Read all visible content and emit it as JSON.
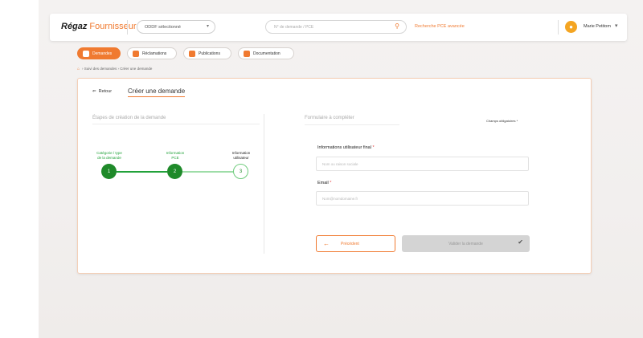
{
  "header": {
    "brand_main": "Régaz",
    "brand_accent": "Fournisseur",
    "pds_select_value": "ODDF sélectionné",
    "search_placeholder": "N° de demande / PCE",
    "advanced_search_label": "Recherche PCE avancée",
    "user_name": "Marie Petitom"
  },
  "nav": {
    "items": [
      {
        "label": "Demandes",
        "active": true
      },
      {
        "label": "Réclamations",
        "active": false
      },
      {
        "label": "Publications",
        "active": false
      },
      {
        "label": "Documentation",
        "active": false
      }
    ]
  },
  "breadcrumb": "› Suivi des demandes › Créer une demande",
  "card": {
    "back_label": "Retour",
    "tab_label": "Créer une demande",
    "steps_title": "Étapes de création de la demande",
    "steps": [
      {
        "label_line1": "Catégorie / type",
        "label_line2": "de la demande",
        "number": "1",
        "state": "done"
      },
      {
        "label_line1": "Information",
        "label_line2": "PCE",
        "number": "2",
        "state": "done"
      },
      {
        "label_line1": "Information",
        "label_line2": "utilisateur",
        "number": "3",
        "state": "todo"
      }
    ],
    "form_title": "Formulaire à compléter",
    "required_note": "Champs obligatoires *",
    "fields": [
      {
        "label": "Informations utilisateur final",
        "required_mark": "*",
        "placeholder": "Nom ou raison sociale"
      },
      {
        "label": "Email",
        "required_mark": "*",
        "placeholder": "Nom@nomdomaine.fr"
      }
    ],
    "prev_label": "Précédent",
    "validate_label": "Valider la demande"
  },
  "colors": {
    "accent": "#f07a30",
    "step_done": "#1f8a2a",
    "step_todo_border": "#6fcc7d",
    "disabled_button": "#d4d4d4"
  }
}
